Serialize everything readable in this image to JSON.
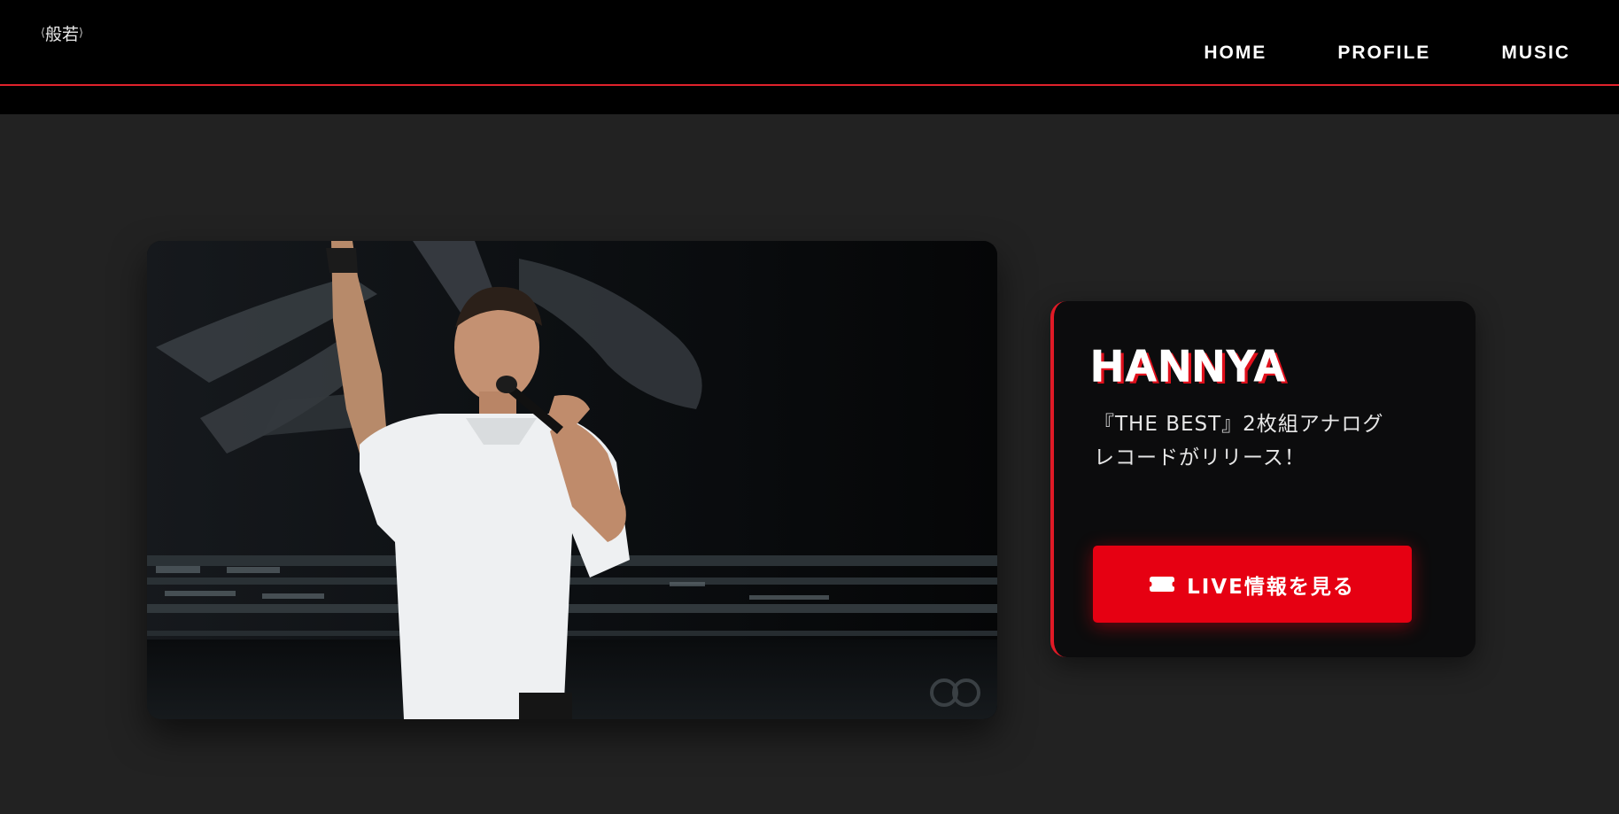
{
  "header": {
    "logo_text": "般若",
    "nav": [
      {
        "label": "HOME"
      },
      {
        "label": "PROFILE"
      },
      {
        "label": "MUSIC"
      }
    ]
  },
  "hero": {
    "image": "live-performance-photo",
    "title": "HANNYA",
    "description_lines": [
      "『THE BEST』2枚組アナログ",
      "レコードがリリース！"
    ],
    "cta_label": "LIVE情報を見る",
    "cta_icon": "ticket-icon"
  },
  "colors": {
    "accent": "#e60012",
    "background": "#222222",
    "header": "#000000",
    "card": "#0c0c0d"
  }
}
